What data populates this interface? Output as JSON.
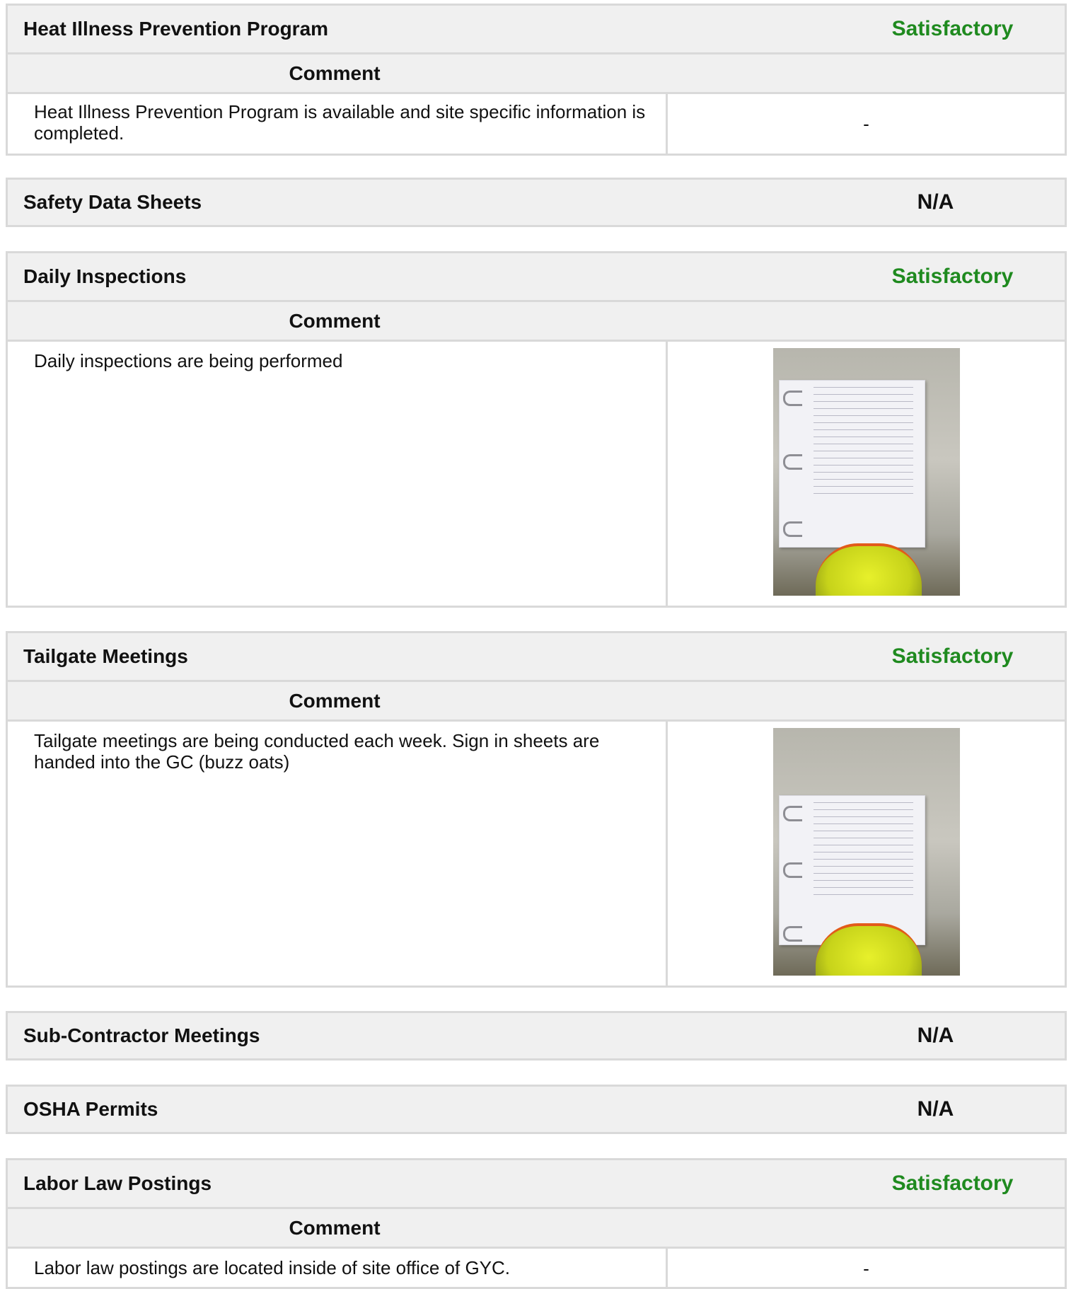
{
  "sections": {
    "heat": {
      "title": "Heat Illness Prevention Program",
      "status": "Satisfactory",
      "comment_header": "Comment",
      "comment": "Heat Illness Prevention Program is available and site specific information is completed.",
      "media": "-"
    },
    "sds": {
      "title": "Safety Data Sheets",
      "status": "N/A"
    },
    "daily": {
      "title": "Daily Inspections",
      "status": "Satisfactory",
      "comment_header": "Comment",
      "comment": "Daily inspections are being performed"
    },
    "tailgate": {
      "title": "Tailgate Meetings",
      "status": "Satisfactory",
      "comment_header": "Comment",
      "comment": "Tailgate meetings are being conducted each week. Sign in sheets are handed into the GC (buzz oats)"
    },
    "subcontractor": {
      "title": "Sub-Contractor Meetings",
      "status": "N/A"
    },
    "osha": {
      "title": "OSHA Permits",
      "status": "N/A"
    },
    "labor": {
      "title": "Labor Law Postings",
      "status": "Satisfactory",
      "comment_header": "Comment",
      "comment": "Labor law postings are located inside of site office of GYC.",
      "media": "-"
    }
  },
  "colors": {
    "satisfactory": "#1f8a1f",
    "header_bg": "#f0f0f0",
    "border": "#d9d9d9"
  }
}
